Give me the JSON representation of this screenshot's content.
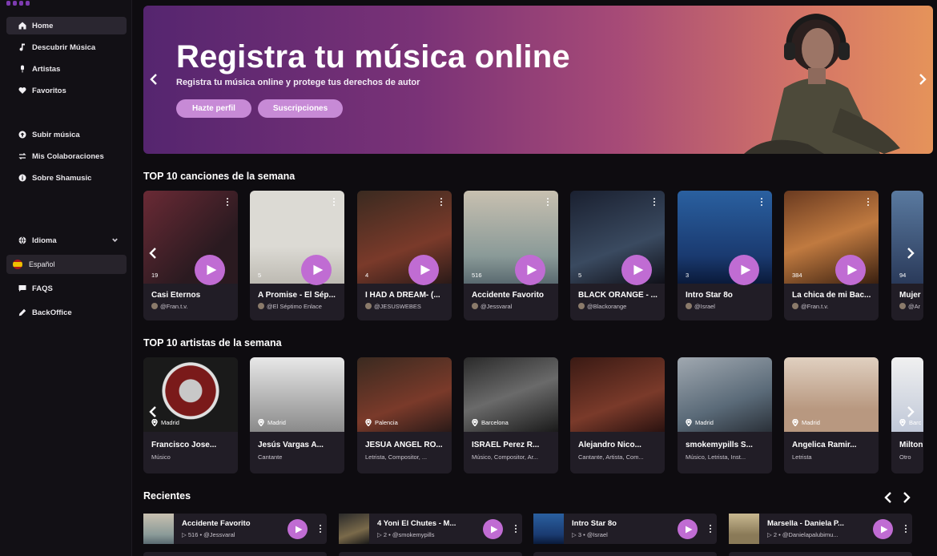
{
  "sidebar": {
    "items": [
      {
        "label": "Home",
        "icon": "home-icon"
      },
      {
        "label": "Descubrir Música",
        "icon": "music-note-icon"
      },
      {
        "label": "Artistas",
        "icon": "microphone-icon"
      },
      {
        "label": "Favoritos",
        "icon": "heart-icon"
      },
      {
        "label": "Subir música",
        "icon": "upload-icon"
      },
      {
        "label": "Mis Colaboraciones",
        "icon": "swap-icon"
      },
      {
        "label": "Sobre Shamusic",
        "icon": "info-icon"
      },
      {
        "label": "Idioma",
        "icon": "globe-icon"
      },
      {
        "label": "Español",
        "icon": "spain-flag-icon"
      },
      {
        "label": "FAQS",
        "icon": "chat-icon"
      },
      {
        "label": "BackOffice",
        "icon": "pencil-icon"
      }
    ],
    "accent": "#2a2630"
  },
  "hero": {
    "title": "Registra tu música online",
    "subtitle": "Registra tu música online y protege tus derechos de autor",
    "button_profile": "Hazte perfil",
    "button_subs": "Suscripciones"
  },
  "songs": {
    "title": "TOP 10 canciones de la semana",
    "items": [
      {
        "title": "Casi Eternos",
        "author": "@Fran.t.v.",
        "plays": "19"
      },
      {
        "title": "A Promise - El Sép...",
        "author": "@El Séptimo Enlace",
        "plays": "5"
      },
      {
        "title": "I HAD A DREAM- (...",
        "author": "@JESUSWEBES",
        "plays": "4"
      },
      {
        "title": "Accidente Favorito",
        "author": "@Jessvaral",
        "plays": "516"
      },
      {
        "title": "BLACK ORANGE - ...",
        "author": "@Blackorange",
        "plays": "5"
      },
      {
        "title": "Intro Star 8o",
        "author": "@Israel",
        "plays": "3"
      },
      {
        "title": "La chica de mi Bac...",
        "author": "@Fran.t.v.",
        "plays": "384"
      },
      {
        "title": "Mujer",
        "author": "@Ar",
        "plays": "94"
      }
    ]
  },
  "artists": {
    "title": "TOP 10 artistas de la semana",
    "items": [
      {
        "name": "Francisco Jose...",
        "roles": "Músico",
        "city": "Madrid"
      },
      {
        "name": "Jesús Vargas A...",
        "roles": "Cantante",
        "city": "Madrid"
      },
      {
        "name": "JESÚA ÁNGEL RO...",
        "roles": "Letrista, Compositor, ...",
        "city": "Palencia"
      },
      {
        "name": "ISRAEL Perez R...",
        "roles": "Músico, Compositor, Ar...",
        "city": "Barcelona"
      },
      {
        "name": "Alejandro Nico...",
        "roles": "Cantante, Artista, Com...",
        "city": ""
      },
      {
        "name": "smokemypills S...",
        "roles": "Músico, Letrista, Inst...",
        "city": "Madrid"
      },
      {
        "name": "Angelica Ramir...",
        "roles": "Letrista",
        "city": "Madrid"
      },
      {
        "name": "Milton",
        "roles": "Otro",
        "city": "Barc"
      }
    ]
  },
  "recent": {
    "title": "Recientes",
    "items": [
      {
        "title": "Accidente Favorito",
        "plays": "516",
        "author": "@Jessvaral"
      },
      {
        "title": "4 Yoni El Chutes - M...",
        "plays": "2",
        "author": "@smokemypills"
      },
      {
        "title": "Intro Star 8o",
        "plays": "3",
        "author": "@Israel"
      },
      {
        "title": "Marsella - Daniela P...",
        "plays": "2",
        "author": "@Danielapalubimu..."
      }
    ]
  },
  "colors": {
    "play": "#c06cd3",
    "card": "#211d26",
    "hero_button": "#c78ad6"
  }
}
